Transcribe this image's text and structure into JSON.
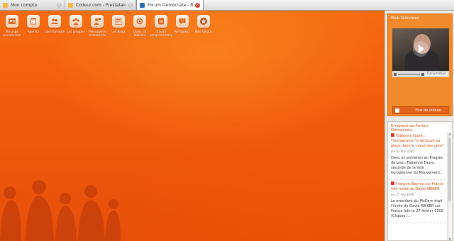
{
  "tabs": [
    {
      "label": "Mon compte",
      "favicon_color": "#f2b84a",
      "active": false
    },
    {
      "label": "Codeur.com - Prestataires freelances",
      "favicon_color": "#f2b84a",
      "active": false
    },
    {
      "label": "Forum Democrate - Bureau",
      "favicon_color": "#2a6db6",
      "active": true
    }
  ],
  "apps": [
    {
      "label": "Ma page\npersonnelle",
      "icon": "profile-card-icon"
    },
    {
      "label": "Agenda",
      "icon": "calendar-icon"
    },
    {
      "label": "Communauté",
      "icon": "community-icon"
    },
    {
      "label": "Les groupes",
      "icon": "groups-icon"
    },
    {
      "label": "Messagerie\ninstantanée",
      "icon": "chat-icon"
    },
    {
      "label": "Les Blogs",
      "icon": "blog-icon"
    },
    {
      "label": "Outils du\nMoDem",
      "icon": "tools-icon"
    },
    {
      "label": "Travail\nprogrammatiq",
      "icon": "work-icon"
    },
    {
      "label": "Participez !",
      "icon": "participate-icon"
    },
    {
      "label": "Mes Favoris",
      "icon": "star-icon"
    }
  ],
  "web_tv": {
    "title": "Web Télévision",
    "player_brand": "Dailymotion",
    "more_button": "Plus de vidéos..."
  },
  "news": {
    "title": "En direct du Forum Démocrate",
    "items": [
      {
        "headline": "Fabienne Faure : l'humanisme \"a retrouvé sa place dans le coeur des gens\"",
        "date": "Jeu 02 Mar 2009",
        "body": "Dans un entretien au Progrès de Lyon, Fabienne Faure, seconde de la liste européenne du Mouvement..."
      },
      {
        "headline": "François Bayrou sur France Info invité de David ABIKER",
        "date": "Jeu 27 Fév 2009",
        "body": "Le président du MoDem était l'invité de David ABIKER sur France Info le 27 février 2009 (Cliquez i..."
      }
    ]
  },
  "colors": {
    "desktop_orange": "#f05a0c",
    "accent": "#d9480f",
    "active_close": "#d43b2f"
  }
}
